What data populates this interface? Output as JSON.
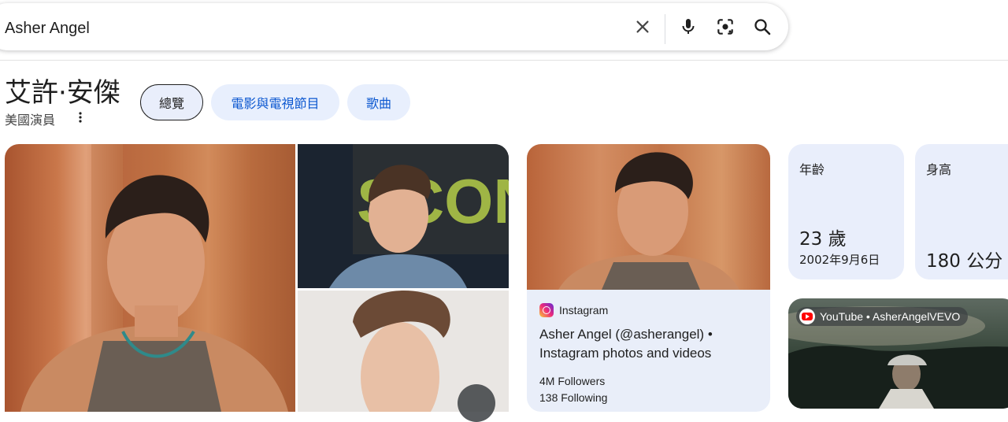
{
  "search": {
    "query": "Asher Angel"
  },
  "icons": {
    "clear": "close-icon",
    "voice": "mic-icon",
    "lens": "camera-lens-icon",
    "search": "search-icon",
    "more": "more-vert-icon",
    "instagram": "instagram-icon",
    "youtube": "youtube-icon"
  },
  "knowledge_panel": {
    "title": "艾許·安傑",
    "subtitle": "美國演員",
    "chips": [
      {
        "label": "總覽",
        "active": true
      },
      {
        "label": "電影與電視節目",
        "active": false
      },
      {
        "label": "歌曲",
        "active": false
      }
    ]
  },
  "instagram_card": {
    "source": "Instagram",
    "title": "Asher Angel (@asherangel) • Instagram photos and videos",
    "followers": "4M Followers",
    "following": "138 Following"
  },
  "facts": [
    {
      "label": "年齡",
      "value": "23 歲",
      "sub": "2002年9月6日"
    },
    {
      "label": "身高",
      "value": "180 公分",
      "sub": ""
    }
  ],
  "youtube_card": {
    "source": "YouTube • AsherAngelVEVO"
  },
  "colors": {
    "chip_bg": "#e8effd",
    "chip_text": "#0b57d0",
    "fact_bg": "#e9eefb",
    "instagram_card_bg": "#e9eef9",
    "youtube_red": "#ff0000"
  }
}
